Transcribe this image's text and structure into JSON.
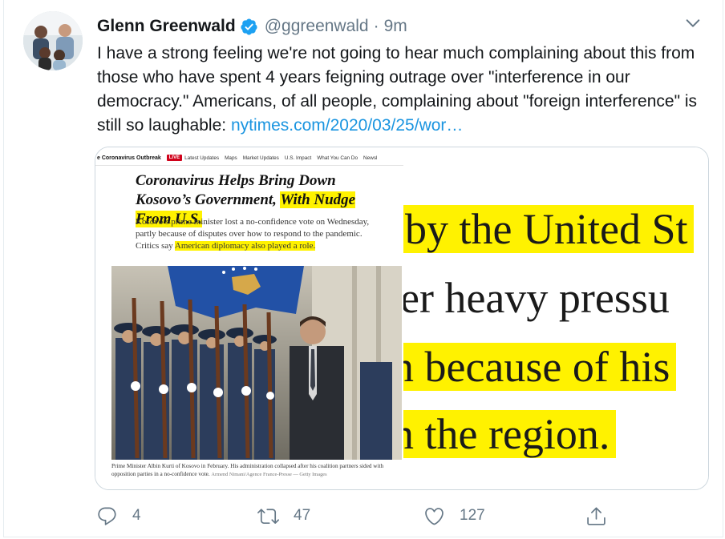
{
  "author": {
    "name": "Glenn Greenwald",
    "handle": "@ggreenwald",
    "separator": "·",
    "time": "9m",
    "verified": true
  },
  "tweet": {
    "text": "I have a strong feeling we're not going to hear much complaining about this from those who have spent 4 years feigning outrage over \"interference in our democracy.\" Americans, of all people, complaining about \"foreign interference\" is still so laughable: ",
    "link_text": "nytimes.com/2020/03/25/wor…"
  },
  "media": {
    "left": {
      "nav": {
        "section": "e Coronavirus Outbreak",
        "live_badge": "LIVE",
        "items": [
          "Latest Updates",
          "Maps",
          "Market Updates",
          "U.S. Impact",
          "What You Can Do",
          "Newsl"
        ]
      },
      "headline_plain": "Coronavirus Helps Bring Down Kosovo’s Government, ",
      "headline_highlight": "With Nudge From U.S.",
      "summary_plain": "Kosovo’s prime minister lost a no-confidence vote on Wednesday, partly because of disputes over how to respond to the pandemic. Critics say ",
      "summary_highlight": "American diplomacy also played a role.",
      "caption": "Prime Minister Albin Kurti of Kosovo in February. His administration collapsed after his coalition partners sided with opposition parties in a no-confidence vote.",
      "credit": "Armend Nimani/Agence France-Presse — Getty Images"
    },
    "right": {
      "lines": [
        "by the United St",
        "er heavy pressu",
        "n because of his",
        "n the region."
      ]
    }
  },
  "actions": {
    "reply_count": "4",
    "retweet_count": "47",
    "like_count": "127"
  },
  "colors": {
    "link": "#1b95e0",
    "muted": "#657786",
    "verified": "#1da1f2",
    "highlight": "#fff200"
  }
}
